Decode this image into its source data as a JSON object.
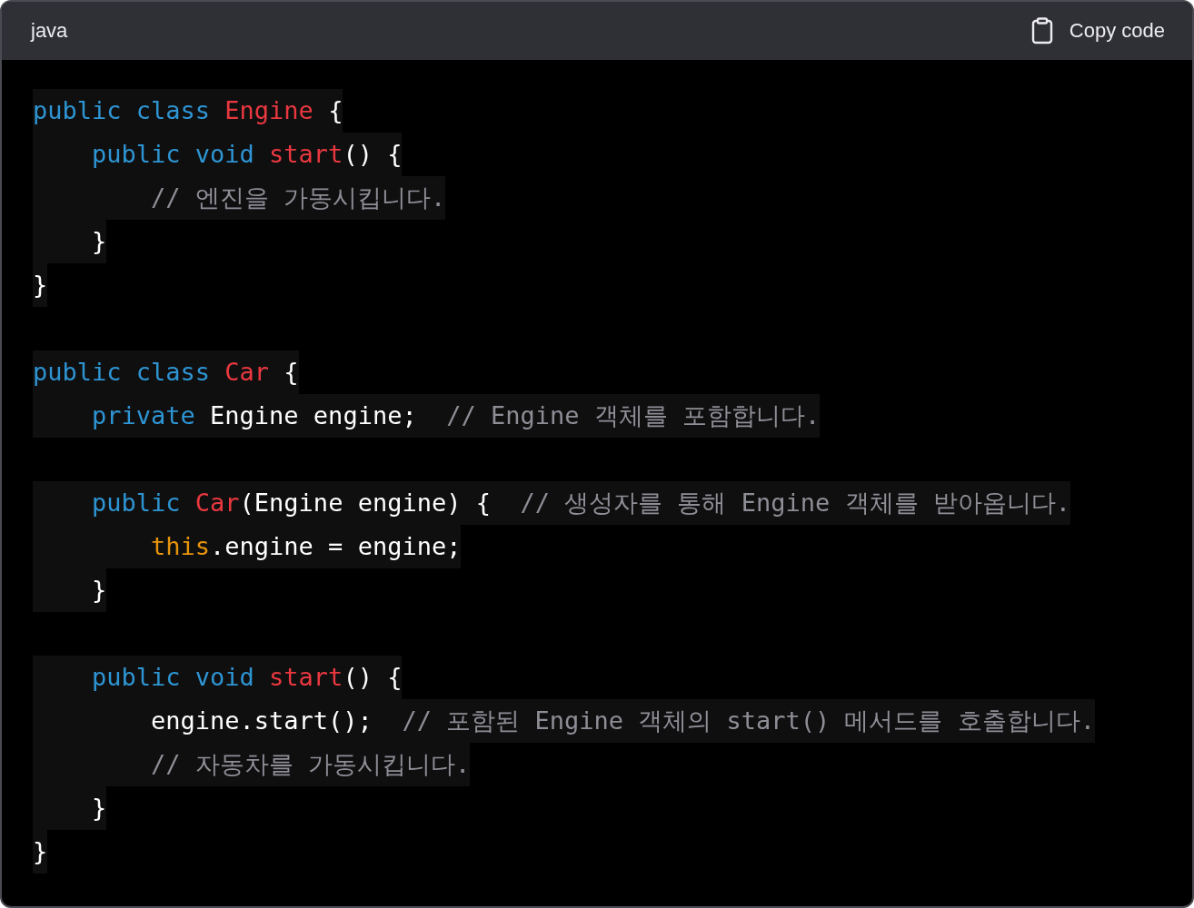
{
  "header": {
    "language": "java",
    "copy_button": "Copy code"
  },
  "code": {
    "groups": [
      {
        "lines": [
          [
            {
              "kind": "keyword",
              "text": "public class "
            },
            {
              "kind": "name",
              "text": "Engine"
            },
            {
              "kind": "plain",
              "text": " {"
            }
          ],
          [
            {
              "kind": "keyword",
              "text": "    public void "
            },
            {
              "kind": "name",
              "text": "start"
            },
            {
              "kind": "plain",
              "text": "() {"
            }
          ],
          [
            {
              "kind": "comment",
              "text": "        // 엔진을 가동시킵니다."
            }
          ],
          [
            {
              "kind": "plain",
              "text": "    }"
            }
          ],
          [
            {
              "kind": "plain",
              "text": "}"
            }
          ]
        ]
      },
      {
        "lines": [
          [
            {
              "kind": "keyword",
              "text": "public class "
            },
            {
              "kind": "name",
              "text": "Car"
            },
            {
              "kind": "plain",
              "text": " {"
            }
          ],
          [
            {
              "kind": "keyword",
              "text": "    private "
            },
            {
              "kind": "plain",
              "text": "Engine engine;  "
            },
            {
              "kind": "comment",
              "text": "// Engine 객체를 포함합니다."
            }
          ]
        ]
      },
      {
        "lines": [
          [
            {
              "kind": "keyword",
              "text": "    public "
            },
            {
              "kind": "name",
              "text": "Car"
            },
            {
              "kind": "plain",
              "text": "(Engine engine) {  "
            },
            {
              "kind": "comment",
              "text": "// 생성자를 통해 Engine 객체를 받아옵니다."
            }
          ],
          [
            {
              "kind": "this",
              "text": "        this"
            },
            {
              "kind": "plain",
              "text": ".engine = engine;"
            }
          ],
          [
            {
              "kind": "plain",
              "text": "    }"
            }
          ]
        ]
      },
      {
        "lines": [
          [
            {
              "kind": "keyword",
              "text": "    public void "
            },
            {
              "kind": "name",
              "text": "start"
            },
            {
              "kind": "plain",
              "text": "() {"
            }
          ],
          [
            {
              "kind": "plain",
              "text": "        engine.start();  "
            },
            {
              "kind": "comment",
              "text": "// 포함된 Engine 객체의 start() 메서드를 호출합니다."
            }
          ],
          [
            {
              "kind": "comment",
              "text": "        // 자동차를 가동시킵니다."
            }
          ],
          [
            {
              "kind": "plain",
              "text": "    }"
            }
          ],
          [
            {
              "kind": "plain",
              "text": "}"
            }
          ]
        ]
      }
    ]
  }
}
